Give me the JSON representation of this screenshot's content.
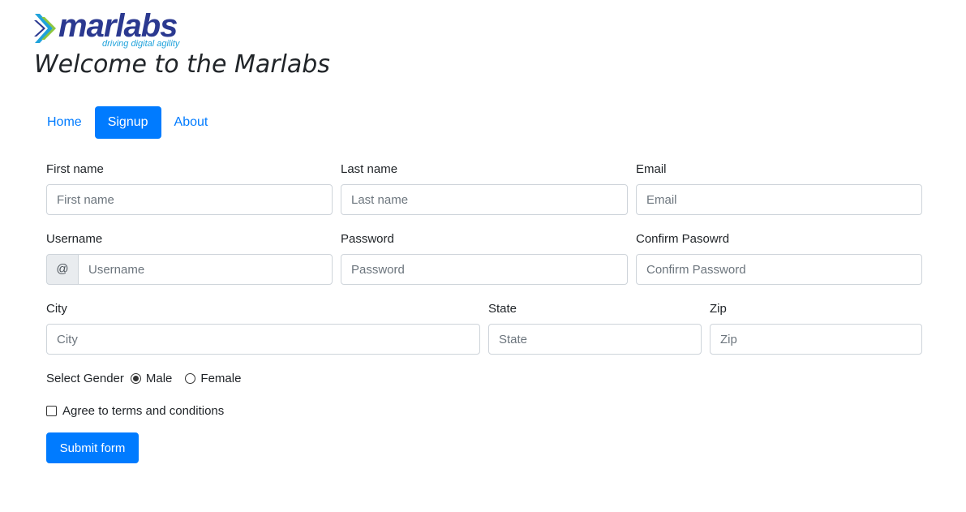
{
  "brand": {
    "name": "marlabs",
    "tagline": "driving digital agility",
    "colors": {
      "primary": "#2b3990",
      "accent": "#1fa2db",
      "green": "#8dc63f"
    }
  },
  "page": {
    "heading": "Welcome to the Marlabs"
  },
  "nav": {
    "items": [
      {
        "label": "Home",
        "active": false
      },
      {
        "label": "Signup",
        "active": true
      },
      {
        "label": "About",
        "active": false
      }
    ]
  },
  "form": {
    "first_name": {
      "label": "First name",
      "placeholder": "First name",
      "value": ""
    },
    "last_name": {
      "label": "Last name",
      "placeholder": "Last name",
      "value": ""
    },
    "email": {
      "label": "Email",
      "placeholder": "Email",
      "value": ""
    },
    "username": {
      "label": "Username",
      "prefix": "@",
      "placeholder": "Username",
      "value": ""
    },
    "password": {
      "label": "Password",
      "placeholder": "Password",
      "value": ""
    },
    "confirm_password": {
      "label": "Confirm Pasowrd",
      "placeholder": "Confirm Password",
      "value": ""
    },
    "city": {
      "label": "City",
      "placeholder": "City",
      "value": ""
    },
    "state": {
      "label": "State",
      "placeholder": "State",
      "value": ""
    },
    "zip": {
      "label": "Zip",
      "placeholder": "Zip",
      "value": ""
    },
    "gender": {
      "label": "Select Gender",
      "options": [
        {
          "label": "Male",
          "selected": true
        },
        {
          "label": "Female",
          "selected": false
        }
      ]
    },
    "terms": {
      "label": "Agree to terms and conditions",
      "checked": false
    },
    "submit_label": "Submit form"
  },
  "colors": {
    "button": "#007bff",
    "border": "#ced4da",
    "addon_bg": "#e9ecef"
  }
}
